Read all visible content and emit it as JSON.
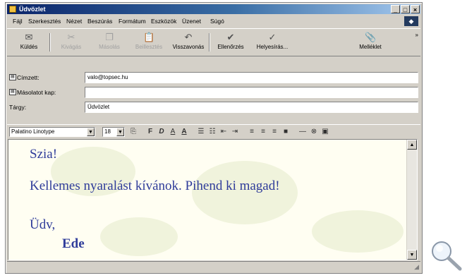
{
  "window": {
    "title": "Üdvözlet"
  },
  "menu": [
    "Fájl",
    "Szerkesztés",
    "Nézet",
    "Beszúrás",
    "Formátum",
    "Eszközök",
    "Üzenet",
    "Súgó"
  ],
  "toolbar": [
    {
      "label": "Küldés",
      "icon": "send-icon",
      "enabled": true
    },
    {
      "label": "Kivágás",
      "icon": "cut-icon",
      "enabled": false
    },
    {
      "label": "Másolás",
      "icon": "copy-icon",
      "enabled": false
    },
    {
      "label": "Beillesztés",
      "icon": "paste-icon",
      "enabled": false
    },
    {
      "label": "Visszavonás",
      "icon": "undo-icon",
      "enabled": true
    },
    {
      "label": "Ellenőrzés",
      "icon": "check-names-icon",
      "enabled": true
    },
    {
      "label": "Helyesírás...",
      "icon": "spelling-icon",
      "enabled": true
    },
    {
      "label": "Melléklet",
      "icon": "attach-icon",
      "enabled": true
    }
  ],
  "headers": {
    "to_label": "Címzett:",
    "to_value": "valo@topsec.hu",
    "cc_label": "Másolatot kap:",
    "cc_value": "",
    "subject_label": "Tárgy:",
    "subject_value": "Üdvözlet"
  },
  "format": {
    "font": "Palatino Linotype",
    "size": "18"
  },
  "body": {
    "line1": "Szia!",
    "line2": "Kellemes nyaralást kívánok. Pihend ki magad!",
    "line3": "Üdv,",
    "line4": "Ede"
  },
  "colors": {
    "text": "#2f3c9a",
    "titlebar": "#0a246a",
    "chrome": "#d4d0c8"
  }
}
